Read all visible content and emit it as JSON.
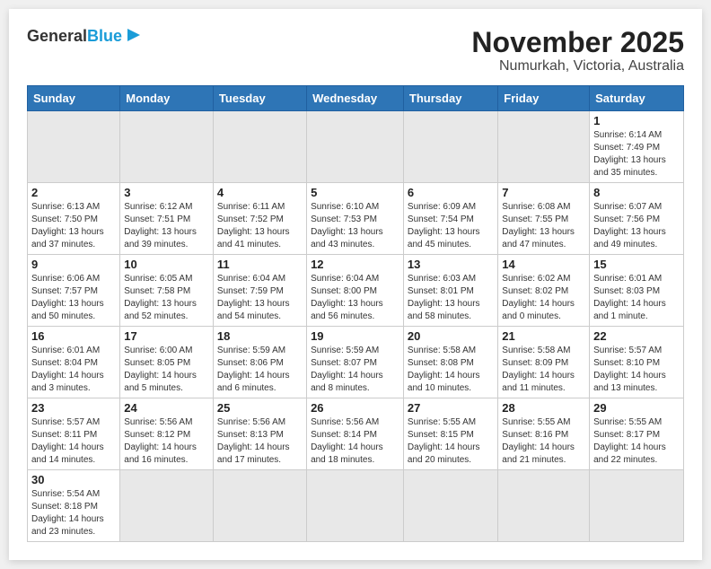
{
  "header": {
    "logo_general": "General",
    "logo_blue": "Blue",
    "title": "November 2025",
    "subtitle": "Numurkah, Victoria, Australia"
  },
  "days_of_week": [
    "Sunday",
    "Monday",
    "Tuesday",
    "Wednesday",
    "Thursday",
    "Friday",
    "Saturday"
  ],
  "weeks": [
    [
      {
        "day": "",
        "info": ""
      },
      {
        "day": "",
        "info": ""
      },
      {
        "day": "",
        "info": ""
      },
      {
        "day": "",
        "info": ""
      },
      {
        "day": "",
        "info": ""
      },
      {
        "day": "",
        "info": ""
      },
      {
        "day": "1",
        "info": "Sunrise: 6:14 AM\nSunset: 7:49 PM\nDaylight: 13 hours and 35 minutes."
      }
    ],
    [
      {
        "day": "2",
        "info": "Sunrise: 6:13 AM\nSunset: 7:50 PM\nDaylight: 13 hours and 37 minutes."
      },
      {
        "day": "3",
        "info": "Sunrise: 6:12 AM\nSunset: 7:51 PM\nDaylight: 13 hours and 39 minutes."
      },
      {
        "day": "4",
        "info": "Sunrise: 6:11 AM\nSunset: 7:52 PM\nDaylight: 13 hours and 41 minutes."
      },
      {
        "day": "5",
        "info": "Sunrise: 6:10 AM\nSunset: 7:53 PM\nDaylight: 13 hours and 43 minutes."
      },
      {
        "day": "6",
        "info": "Sunrise: 6:09 AM\nSunset: 7:54 PM\nDaylight: 13 hours and 45 minutes."
      },
      {
        "day": "7",
        "info": "Sunrise: 6:08 AM\nSunset: 7:55 PM\nDaylight: 13 hours and 47 minutes."
      },
      {
        "day": "8",
        "info": "Sunrise: 6:07 AM\nSunset: 7:56 PM\nDaylight: 13 hours and 49 minutes."
      }
    ],
    [
      {
        "day": "9",
        "info": "Sunrise: 6:06 AM\nSunset: 7:57 PM\nDaylight: 13 hours and 50 minutes."
      },
      {
        "day": "10",
        "info": "Sunrise: 6:05 AM\nSunset: 7:58 PM\nDaylight: 13 hours and 52 minutes."
      },
      {
        "day": "11",
        "info": "Sunrise: 6:04 AM\nSunset: 7:59 PM\nDaylight: 13 hours and 54 minutes."
      },
      {
        "day": "12",
        "info": "Sunrise: 6:04 AM\nSunset: 8:00 PM\nDaylight: 13 hours and 56 minutes."
      },
      {
        "day": "13",
        "info": "Sunrise: 6:03 AM\nSunset: 8:01 PM\nDaylight: 13 hours and 58 minutes."
      },
      {
        "day": "14",
        "info": "Sunrise: 6:02 AM\nSunset: 8:02 PM\nDaylight: 14 hours and 0 minutes."
      },
      {
        "day": "15",
        "info": "Sunrise: 6:01 AM\nSunset: 8:03 PM\nDaylight: 14 hours and 1 minute."
      }
    ],
    [
      {
        "day": "16",
        "info": "Sunrise: 6:01 AM\nSunset: 8:04 PM\nDaylight: 14 hours and 3 minutes."
      },
      {
        "day": "17",
        "info": "Sunrise: 6:00 AM\nSunset: 8:05 PM\nDaylight: 14 hours and 5 minutes."
      },
      {
        "day": "18",
        "info": "Sunrise: 5:59 AM\nSunset: 8:06 PM\nDaylight: 14 hours and 6 minutes."
      },
      {
        "day": "19",
        "info": "Sunrise: 5:59 AM\nSunset: 8:07 PM\nDaylight: 14 hours and 8 minutes."
      },
      {
        "day": "20",
        "info": "Sunrise: 5:58 AM\nSunset: 8:08 PM\nDaylight: 14 hours and 10 minutes."
      },
      {
        "day": "21",
        "info": "Sunrise: 5:58 AM\nSunset: 8:09 PM\nDaylight: 14 hours and 11 minutes."
      },
      {
        "day": "22",
        "info": "Sunrise: 5:57 AM\nSunset: 8:10 PM\nDaylight: 14 hours and 13 minutes."
      }
    ],
    [
      {
        "day": "23",
        "info": "Sunrise: 5:57 AM\nSunset: 8:11 PM\nDaylight: 14 hours and 14 minutes."
      },
      {
        "day": "24",
        "info": "Sunrise: 5:56 AM\nSunset: 8:12 PM\nDaylight: 14 hours and 16 minutes."
      },
      {
        "day": "25",
        "info": "Sunrise: 5:56 AM\nSunset: 8:13 PM\nDaylight: 14 hours and 17 minutes."
      },
      {
        "day": "26",
        "info": "Sunrise: 5:56 AM\nSunset: 8:14 PM\nDaylight: 14 hours and 18 minutes."
      },
      {
        "day": "27",
        "info": "Sunrise: 5:55 AM\nSunset: 8:15 PM\nDaylight: 14 hours and 20 minutes."
      },
      {
        "day": "28",
        "info": "Sunrise: 5:55 AM\nSunset: 8:16 PM\nDaylight: 14 hours and 21 minutes."
      },
      {
        "day": "29",
        "info": "Sunrise: 5:55 AM\nSunset: 8:17 PM\nDaylight: 14 hours and 22 minutes."
      }
    ],
    [
      {
        "day": "30",
        "info": "Sunrise: 5:54 AM\nSunset: 8:18 PM\nDaylight: 14 hours and 23 minutes."
      },
      {
        "day": "",
        "info": ""
      },
      {
        "day": "",
        "info": ""
      },
      {
        "day": "",
        "info": ""
      },
      {
        "day": "",
        "info": ""
      },
      {
        "day": "",
        "info": ""
      },
      {
        "day": "",
        "info": ""
      }
    ]
  ]
}
